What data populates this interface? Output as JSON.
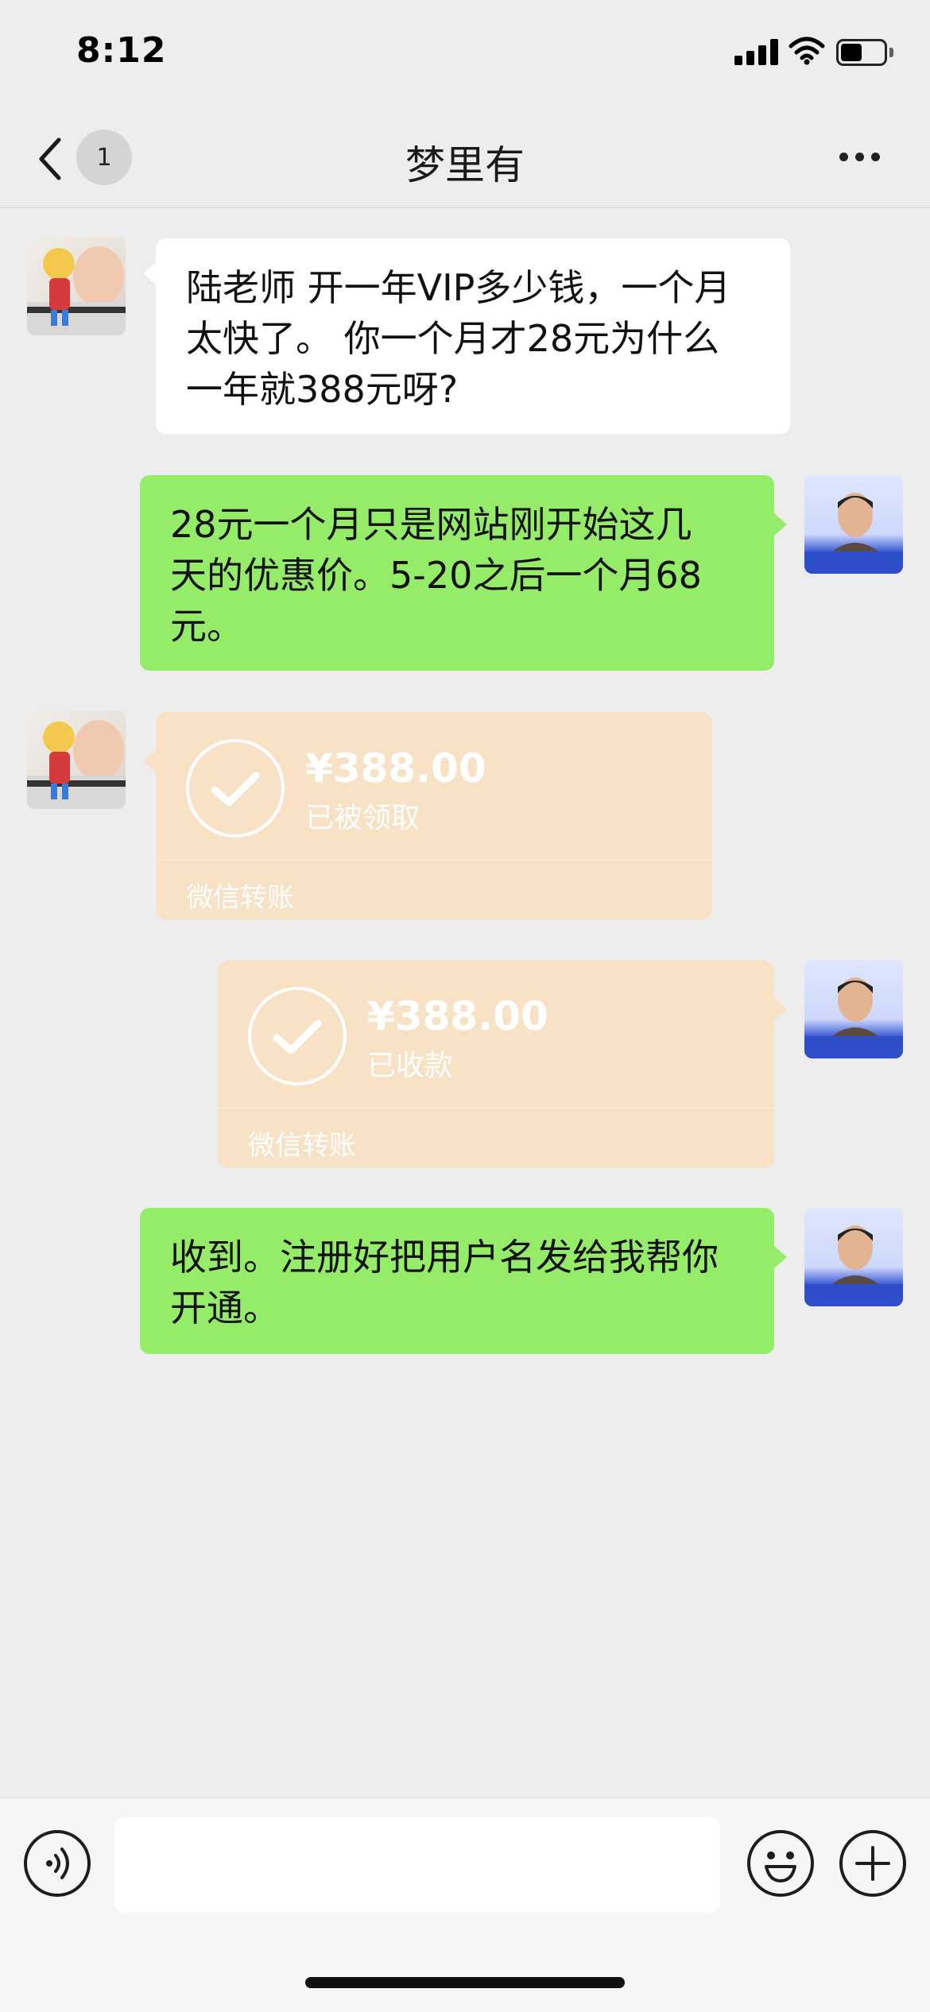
{
  "status_bar": {
    "time": "8:12",
    "signal_icon": "signal-bars-icon",
    "wifi_icon": "wifi-icon",
    "battery_icon": "battery-icon",
    "battery_level": 0.5
  },
  "nav": {
    "back_icon": "chevron-left-icon",
    "unread_count": "1",
    "title": "梦里有",
    "more_icon": "ellipsis-icon"
  },
  "messages": [
    {
      "sender": "contact",
      "type": "text",
      "lines": [
        "陆老师 开一年VIP多少钱，一个月",
        "太快了。 你一个月才28元为什么",
        "一年就388元呀?"
      ]
    },
    {
      "sender": "me",
      "type": "text",
      "lines": [
        "28元一个月只是网站刚开始这几",
        "天的优惠价。5-20之后一个月68",
        "元。"
      ]
    },
    {
      "sender": "contact",
      "type": "transfer",
      "amount": "¥388.00",
      "status": "已被领取",
      "label": "微信转账"
    },
    {
      "sender": "me",
      "type": "transfer",
      "amount": "¥388.00",
      "status": "已收款",
      "label": "微信转账"
    },
    {
      "sender": "me",
      "type": "text",
      "lines": [
        "收到。注册好把用户名发给我帮你",
        "开通。"
      ]
    }
  ],
  "input_bar": {
    "voice_icon": "voice-icon",
    "emoji_icon": "emoji-icon",
    "plus_icon": "plus-icon",
    "text_value": ""
  },
  "colors": {
    "background": "#ededed",
    "incoming_bubble": "#ffffff",
    "outgoing_bubble": "#95ec69",
    "transfer_card": "#f8e2c5"
  }
}
